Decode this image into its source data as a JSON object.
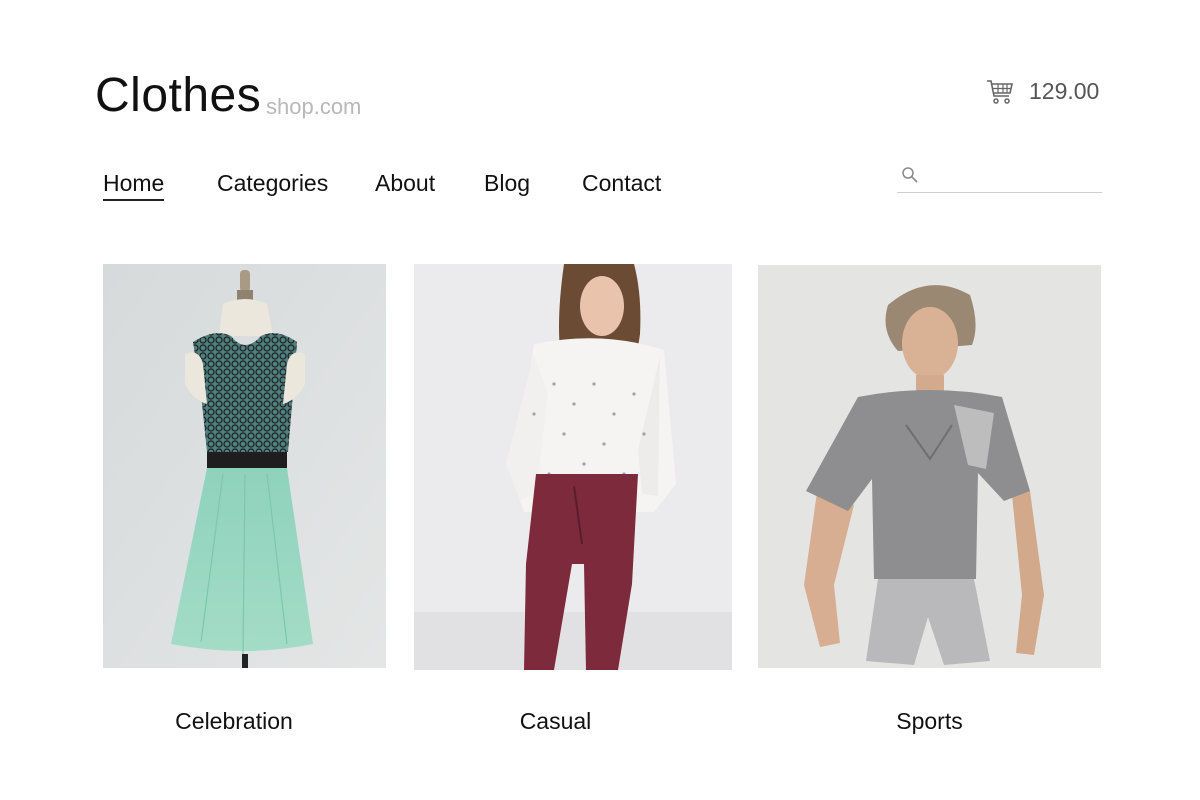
{
  "header": {
    "brand": "Clothes",
    "brand_suffix": "shop.com",
    "cart_total": "129.00",
    "cart_icon": "shopping-cart-icon"
  },
  "nav": {
    "items": [
      {
        "label": "Home",
        "active": true
      },
      {
        "label": "Categories",
        "active": false
      },
      {
        "label": "About",
        "active": false
      },
      {
        "label": "Blog",
        "active": false
      },
      {
        "label": "Contact",
        "active": false
      }
    ]
  },
  "search": {
    "icon": "search-icon",
    "placeholder": "",
    "value": ""
  },
  "categories": [
    {
      "label": "Celebration"
    },
    {
      "label": "Casual"
    },
    {
      "label": "Sports"
    }
  ],
  "colors": {
    "text": "#111111",
    "muted": "#b8b8b8",
    "cart_text": "#555555"
  }
}
